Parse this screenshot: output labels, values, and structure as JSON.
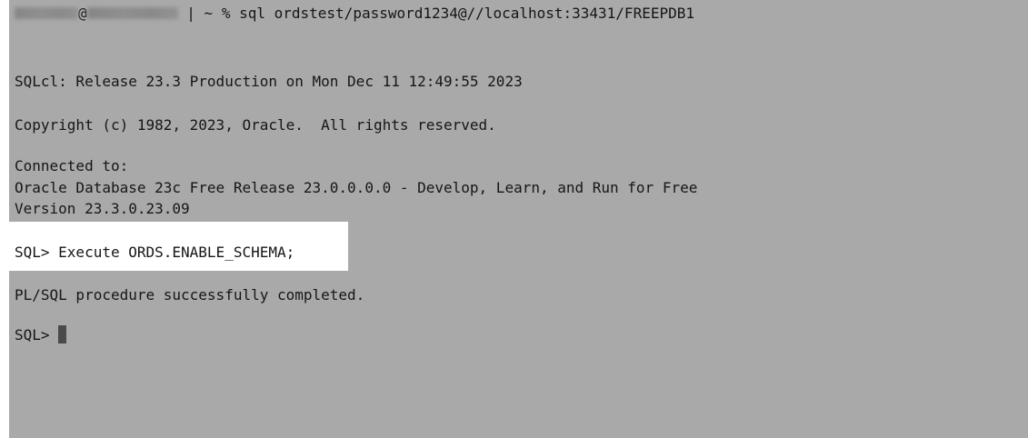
{
  "terminal": {
    "prompt_command": {
      "at": "@",
      "bar": "|",
      "text": " ~ % sql ordstest/password1234@//localhost:33431/FREEPDB1"
    },
    "lines": {
      "release": "SQLcl: Release 23.3 Production on Mon Dec 11 12:49:55 2023",
      "copyright": "Copyright (c) 1982, 2023, Oracle.  All rights reserved.",
      "connected": "Connected to:",
      "database": "Oracle Database 23c Free Release 23.0.0.0.0 - Develop, Learn, and Run for Free",
      "version": "Version 23.3.0.23.09",
      "execute_command": "SQL> Execute ORDS.ENABLE_SCHEMA;",
      "result": "PL/SQL procedure successfully completed.",
      "final_prompt": "SQL> "
    },
    "colors": {
      "background": "#a9a9a9",
      "highlight": "#ffffff",
      "text": "#161616",
      "cursor": "#4a4a4a"
    }
  }
}
